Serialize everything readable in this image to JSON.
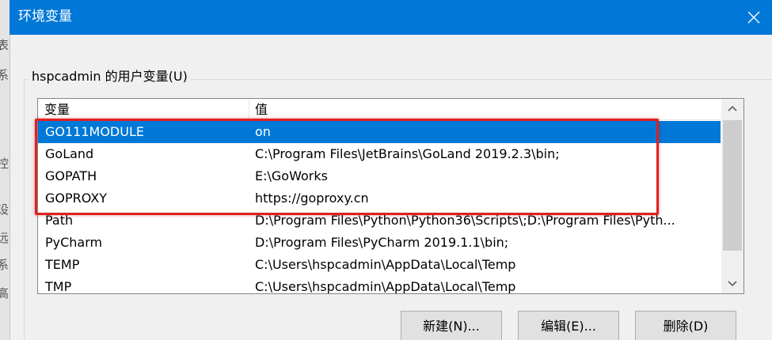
{
  "window": {
    "title": "环境变量"
  },
  "background_fragments": [
    "表",
    "系",
    "控",
    "设",
    "远",
    "系",
    "高"
  ],
  "user_vars": {
    "group_label": "hspcadmin 的用户变量(U)",
    "columns": {
      "name": "变量",
      "value": "值"
    },
    "rows": [
      {
        "name": "GO111MODULE",
        "value": "on",
        "selected": true
      },
      {
        "name": "GoLand",
        "value": "C:\\Program Files\\JetBrains\\GoLand 2019.2.3\\bin;",
        "selected": false
      },
      {
        "name": "GOPATH",
        "value": "E:\\GoWorks",
        "selected": false
      },
      {
        "name": "GOPROXY",
        "value": "https://goproxy.cn",
        "selected": false
      },
      {
        "name": "Path",
        "value": "D:\\Program Files\\Python\\Python36\\Scripts\\;D:\\Program Files\\Pyth...",
        "selected": false
      },
      {
        "name": "PyCharm",
        "value": "D:\\Program Files\\PyCharm 2019.1.1\\bin;",
        "selected": false
      },
      {
        "name": "TEMP",
        "value": "C:\\Users\\hspcadmin\\AppData\\Local\\Temp",
        "selected": false
      },
      {
        "name": "TMP",
        "value": "C:\\Users\\hspcadmin\\AppData\\Local\\Temp",
        "selected": false
      }
    ]
  },
  "buttons": {
    "new": "新建(N)...",
    "edit": "编辑(E)...",
    "delete": "删除(D)"
  },
  "colors": {
    "titlebar": "#0078d7",
    "selection": "#0078d7",
    "highlight": "#e02020"
  },
  "icons": {
    "close": "close-icon",
    "scroll_up": "chevron-up-icon",
    "scroll_down": "chevron-down-icon"
  }
}
